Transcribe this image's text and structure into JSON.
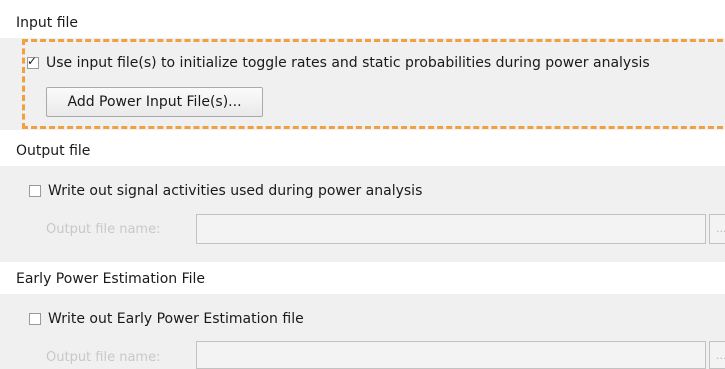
{
  "input_section": {
    "title": "Input file",
    "use_input_checkbox": {
      "checked": true,
      "check_glyph": "✓",
      "label": "Use input file(s) to initialize toggle rates and static probabilities during power analysis"
    },
    "add_button_label": "Add Power Input File(s)...",
    "highlight_color": "#f0a040"
  },
  "output_section": {
    "title": "Output file",
    "write_activities_checkbox": {
      "checked": false,
      "label": "Write out signal activities used during power analysis"
    },
    "output_file_label": "Output file name:",
    "output_file_value": "",
    "browse_label": "..."
  },
  "early_section": {
    "title": "Early Power Estimation File",
    "write_early_checkbox": {
      "checked": false,
      "label": "Write out Early Power Estimation file"
    },
    "output_file_label": "Output file name:",
    "output_file_value": "",
    "browse_label": "..."
  }
}
